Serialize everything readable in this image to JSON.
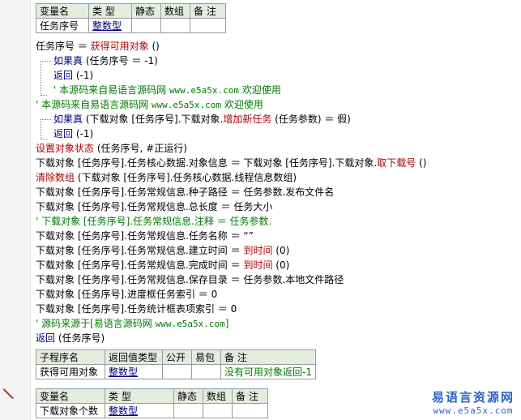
{
  "var_table": {
    "headers": [
      "变量名",
      "类 型",
      "静态",
      "数组",
      "备 注"
    ],
    "row": [
      "任务序号",
      "整数型",
      "",
      "",
      ""
    ]
  },
  "code": {
    "l1": [
      "任务序号 ＝ ",
      "获得可用对象",
      " ()"
    ],
    "l2": [
      "如果真",
      " (任务序号 ＝ -1)"
    ],
    "l3": [
      "返回",
      " (-1)"
    ],
    "l4": [
      "' 本源码来自易语言源码网 ",
      "www.e5a5x.com",
      "  欢迎使用"
    ],
    "l5": [
      "' 本源码来自易语言源码网 ",
      "www.e5a5x.com",
      "  欢迎使用"
    ],
    "l6": [
      "如果真",
      " (下载对象 [任务序号].下载对象.",
      "增加新任务",
      " (任务参数) ＝ 假)"
    ],
    "l7": [
      "返回",
      " (-1)"
    ],
    "l8": [
      "设置对象状态",
      " (任务序号, #正运行)"
    ],
    "l9": [
      "下载对象 [任务序号].任务核心数据.对象信息 ＝ 下载对象 [任务序号].下载对象.",
      "取下载号",
      " ()"
    ],
    "l10": [
      "清除数组",
      " (下载对象 [任务序号].任务核心数据.线程信息数组)"
    ],
    "l11": "下载对象 [任务序号].任务常规信息.种子路径 ＝ 任务参数.发布文件名",
    "l12": "下载对象 [任务序号].任务常规信息.总长度 ＝ 任务大小",
    "l13": "' 下载对象 [任务序号].任务常规信息.注释 ＝ 任务参数.",
    "l14": "下载对象 [任务序号].任务常规信息.任务名称 ＝ “”",
    "l15": [
      "下载对象 [任务序号].任务常规信息.建立时间 ＝ ",
      "到时间",
      " (0)"
    ],
    "l16": [
      "下载对象 [任务序号].任务常规信息.完成时间 ＝ ",
      "到时间",
      " (0)"
    ],
    "l17": "下载对象 [任务序号].任务常规信息.保存目录 ＝ 任务参数.本地文件路径",
    "l18": "下载对象 [任务序号].进度框任务索引 ＝ 0",
    "l19": "下载对象 [任务序号].任务统计框表项索引 ＝ 0",
    "l20": [
      "' 源码来源于[易语言源码网 ",
      "www.e5a5x.com",
      "]"
    ],
    "l21": [
      "返回",
      " (任务序号)"
    ]
  },
  "sub_table": {
    "headers": [
      "子程序名",
      "返回值类型",
      "公开",
      "易包",
      "备 注"
    ],
    "row": [
      "获得可用对象",
      "整数型",
      "",
      "",
      "没有可用对象返回-1"
    ]
  },
  "var_table2": {
    "headers": [
      "变量名",
      "类 型",
      "静态",
      "数组",
      "备 注"
    ],
    "row": [
      "下载对象个数",
      "整数型",
      "",
      "",
      ""
    ]
  },
  "watermark": {
    "title": "易语言资源网",
    "url": "www.e5a5x.com"
  },
  "colors": {
    "keyword": "#00007f",
    "command": "#b00000",
    "comment": "#007a00",
    "header_bg": "#e4ecde",
    "watermark": "#2e63c7"
  },
  "icons": [
    "pencil-icon"
  ]
}
